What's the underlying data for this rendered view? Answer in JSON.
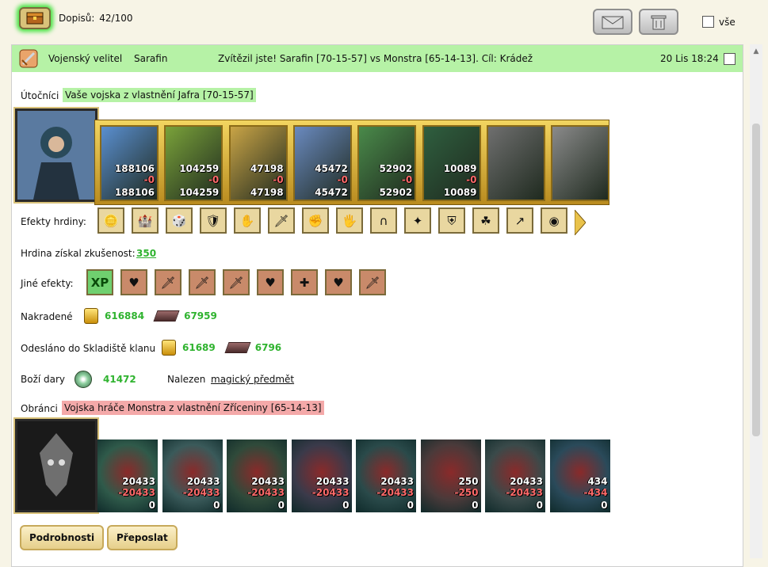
{
  "topbar": {
    "mail_count_label": "Dopisů:",
    "mail_count": "42/100",
    "select_all_label": "vše"
  },
  "message": {
    "type": "Vojenský velitel",
    "from": "Sarafin",
    "subject": "Zvítězil jste! Sarafin [70-15-57] vs Monstra [65-14-13]. Cíl: Krádež",
    "date": "20 Lis 18:24"
  },
  "attackers": {
    "label": "Útočníci",
    "army": "Vaše vojska z vlastnění Jafra [70-15-57]",
    "units": [
      {
        "n1": "188106",
        "n2": "-0",
        "n3": "188106",
        "color": "#5a8fd0"
      },
      {
        "n1": "104259",
        "n2": "-0",
        "n3": "104259",
        "color": "#7aa23a"
      },
      {
        "n1": "47198",
        "n2": "-0",
        "n3": "47198",
        "color": "#c9a446"
      },
      {
        "n1": "45472",
        "n2": "-0",
        "n3": "45472",
        "color": "#6a8ac0"
      },
      {
        "n1": "52902",
        "n2": "-0",
        "n3": "52902",
        "color": "#4a8a4a"
      },
      {
        "n1": "10089",
        "n2": "-0",
        "n3": "10089",
        "color": "#2f5f3f"
      },
      {
        "n1": "",
        "n2": "",
        "n3": "",
        "color": "#6f6f6f"
      },
      {
        "n1": "",
        "n2": "",
        "n3": "",
        "color": "#8a8a8a"
      }
    ]
  },
  "hero_effects": {
    "label": "Efekty hrdiny:",
    "icons": [
      "sack-icon",
      "fortress-icon",
      "dice-icon",
      "shield-icon",
      "hand-shield-icon",
      "sword-icon",
      "hand-sword-icon",
      "hand-icon",
      "horseshoe-icon",
      "crystal-icon",
      "armor-icon",
      "clover-icon",
      "spear-icon",
      "orb-icon"
    ]
  },
  "experience": {
    "label": "Hrdina získal zkušenost:",
    "value": "350"
  },
  "other_effects": {
    "label": "Jiné efekty:",
    "xp": "XP",
    "icons": [
      "heart-icon",
      "sword-icon",
      "sword-icon",
      "sword-icon",
      "heart-icon",
      "cross-icon",
      "heart-icon",
      "sword-icon"
    ]
  },
  "stolen": {
    "label": "Nakradené",
    "gold": "616884",
    "ore": "67959"
  },
  "clan": {
    "label": "Odesláno do Skladiště klanu",
    "gold": "61689",
    "ore": "6796"
  },
  "gifts": {
    "label": "Boží dary",
    "value": "41472",
    "found_label": "Nalezen",
    "found_item": "magický předmět"
  },
  "defenders": {
    "label": "Obránci",
    "army": "Vojska hráče Monstra z vlastnění Zříceniny [65-14-13]",
    "units": [
      {
        "n1": "20433",
        "n2": "-20433",
        "n3": "0",
        "color": "#2f5a4a"
      },
      {
        "n1": "20433",
        "n2": "-20433",
        "n3": "0",
        "color": "#3a5a5a"
      },
      {
        "n1": "20433",
        "n2": "-20433",
        "n3": "0",
        "color": "#2f4a3a"
      },
      {
        "n1": "20433",
        "n2": "-20433",
        "n3": "0",
        "color": "#3a3a4a"
      },
      {
        "n1": "20433",
        "n2": "-20433",
        "n3": "0",
        "color": "#2a4a4a"
      },
      {
        "n1": "250",
        "n2": "-250",
        "n3": "0",
        "color": "#4a3a3a"
      },
      {
        "n1": "20433",
        "n2": "-20433",
        "n3": "0",
        "color": "#3a4a4a"
      },
      {
        "n1": "434",
        "n2": "-434",
        "n3": "0",
        "color": "#2a4a5a"
      }
    ]
  },
  "buttons": {
    "details": "Podrobnosti",
    "forward": "Přeposlat"
  }
}
